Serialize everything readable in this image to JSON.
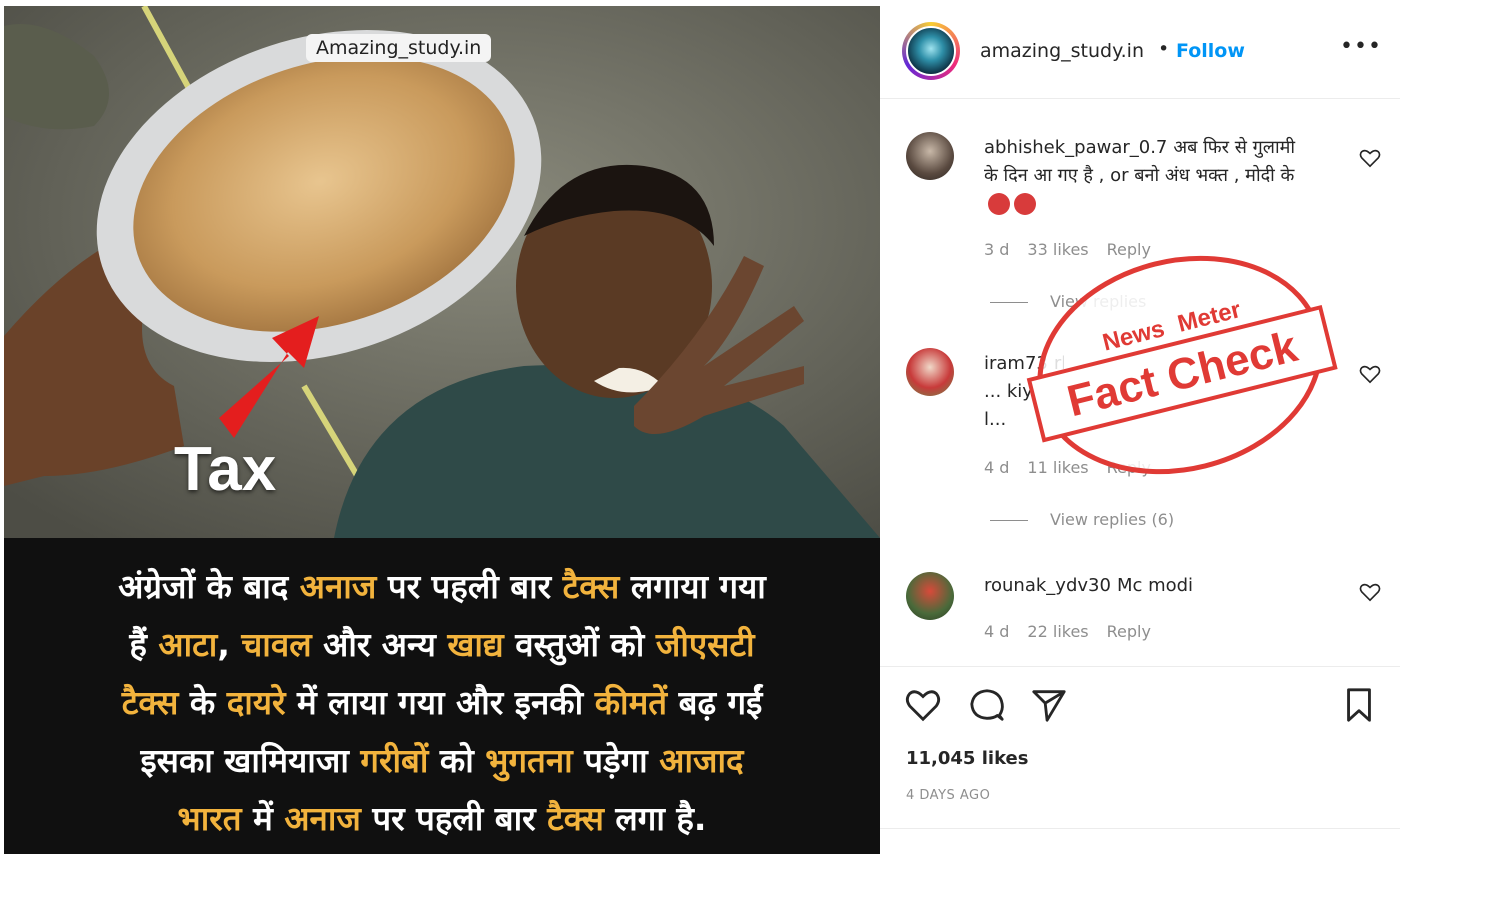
{
  "post": {
    "watermark": "Amazing_study.in",
    "tax_label": "Tax",
    "caption_lines": [
      [
        {
          "t": "अंग्रेजों के बाद ",
          "h": false
        },
        {
          "t": "अनाज",
          "h": true
        },
        {
          "t": " पर पहली बार ",
          "h": false
        },
        {
          "t": "टैक्स",
          "h": true
        },
        {
          "t": " लगाया गया",
          "h": false
        }
      ],
      [
        {
          "t": "हैं ",
          "h": false
        },
        {
          "t": "आटा",
          "h": true
        },
        {
          "t": ", ",
          "h": false
        },
        {
          "t": "चावल",
          "h": true
        },
        {
          "t": " और अन्य ",
          "h": false
        },
        {
          "t": "खाद्य",
          "h": true
        },
        {
          "t": " वस्तुओं को ",
          "h": false
        },
        {
          "t": "जीएसटी",
          "h": true
        }
      ],
      [
        {
          "t": "टैक्स",
          "h": true
        },
        {
          "t": " के ",
          "h": false
        },
        {
          "t": "दायरे",
          "h": true
        },
        {
          "t": " में लाया गया और इनकी ",
          "h": false
        },
        {
          "t": "कीमतें",
          "h": true
        },
        {
          "t": " बढ़ गईं",
          "h": false
        }
      ],
      [
        {
          "t": "इसका खामियाजा ",
          "h": false
        },
        {
          "t": "गरीबों",
          "h": true
        },
        {
          "t": " को ",
          "h": false
        },
        {
          "t": "भुगतना",
          "h": true
        },
        {
          "t": " पड़ेगा ",
          "h": false
        },
        {
          "t": "आजाद",
          "h": true
        }
      ],
      [
        {
          "t": "भारत",
          "h": true
        },
        {
          "t": " में ",
          "h": false
        },
        {
          "t": "अनाज",
          "h": true
        },
        {
          "t": " पर पहली बार ",
          "h": false
        },
        {
          "t": "टैक्स",
          "h": true
        },
        {
          "t": " लगा है.",
          "h": false
        }
      ]
    ]
  },
  "header": {
    "username": "amazing_study.in",
    "separator": "•",
    "follow_label": "Follow",
    "more_icon": "more-icon"
  },
  "comments": [
    {
      "user": "abhishek_pawar_0.7",
      "text": "अब फिर से गुलामी के दिन आ गए है , or बनो अंध भक्त , मोदी के",
      "time": "3 d",
      "likes": "33 likes",
      "reply": "Reply",
      "view_replies": "View replies"
    },
    {
      "user": "iram73",
      "text": "rkha ... kiya l...",
      "time": "4 d",
      "likes": "11 likes",
      "reply": "Reply",
      "view_replies": "View replies (6)"
    },
    {
      "user": "rounak_ydv30",
      "text": "Mc modi",
      "time": "4 d",
      "likes": "22 likes",
      "reply": "Reply"
    }
  ],
  "actions": {
    "likes": "11,045 likes",
    "date": "4 DAYS AGO"
  },
  "stamp": {
    "brand_news": "News",
    "brand_meter": "Meter",
    "label": "Fact Check",
    "color": "#e03a35"
  },
  "colors": {
    "accent": "#0095f6",
    "highlight": "#f2b33d"
  }
}
